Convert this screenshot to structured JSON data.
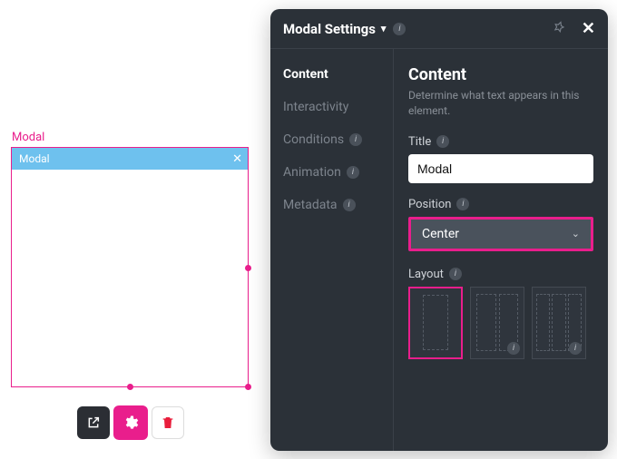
{
  "canvas": {
    "element_label": "Modal",
    "header_text": "Modal"
  },
  "panel": {
    "title": "Modal Settings",
    "tabs": [
      {
        "label": "Content",
        "active": true
      },
      {
        "label": "Interactivity",
        "active": false
      },
      {
        "label": "Conditions",
        "active": false,
        "info": true
      },
      {
        "label": "Animation",
        "active": false,
        "info": true
      },
      {
        "label": "Metadata",
        "active": false,
        "info": true
      }
    ],
    "section": {
      "title": "Content",
      "description": "Determine what text appears in this element.",
      "fields": {
        "title_label": "Title",
        "title_value": "Modal",
        "position_label": "Position",
        "position_value": "Center",
        "layout_label": "Layout"
      }
    }
  }
}
